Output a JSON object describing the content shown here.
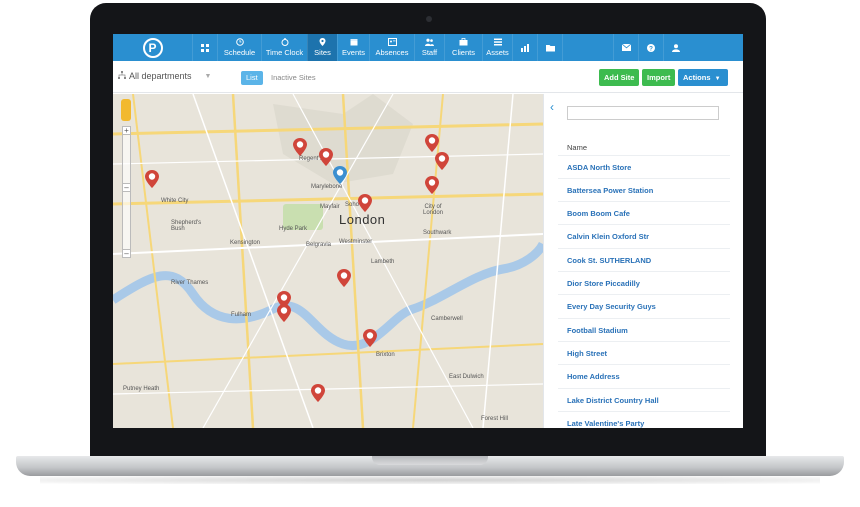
{
  "app": {
    "logo_letter": "P"
  },
  "nav": {
    "items": [
      {
        "label": "Schedule",
        "icon": "clock-icon"
      },
      {
        "label": "Time Clock",
        "icon": "stopwatch-icon"
      },
      {
        "label": "Sites",
        "icon": "map-pin-icon",
        "active": true
      },
      {
        "label": "Events",
        "icon": "calendar-icon"
      },
      {
        "label": "Absences",
        "icon": "id-card-icon"
      },
      {
        "label": "Staff",
        "icon": "people-icon"
      },
      {
        "label": "Clients",
        "icon": "briefcase-icon"
      },
      {
        "label": "Assets",
        "icon": "list-icon"
      }
    ],
    "right_icons": [
      "bar-chart-icon",
      "folder-icon",
      "mail-icon",
      "help-icon",
      "user-icon"
    ]
  },
  "toolbar": {
    "department": "All departments",
    "tab_active": "List",
    "tab_inactive": "Inactive Sites",
    "add_site": "Add Site",
    "import": "Import",
    "actions": "Actions"
  },
  "map": {
    "city": "London",
    "labels": [
      "Regent's",
      "Marylebone",
      "Soho",
      "Mayfair",
      "City of London",
      "White City",
      "Shepherd's Bush",
      "Hyde Park",
      "Kensington",
      "Belgravia",
      "Westminster",
      "Southwark",
      "Lambeth",
      "Fulham",
      "Camberwell",
      "Brixton",
      "East Dulwich",
      "Putney Heath",
      "River Thames",
      "Forest Hill"
    ]
  },
  "sidebar": {
    "search_placeholder": "",
    "column_header": "Name",
    "sites": [
      "ASDA North Store",
      "Battersea Power Station",
      "Boom Boom Cafe",
      "Calvin Klein Oxford Str",
      "Cook St. SUTHERLAND",
      "Dior Store Piccadilly",
      "Every Day Security Guys",
      "Football Stadium",
      "High Street",
      "Home Address",
      "Lake District Country Hall",
      "Late Valentine's Party"
    ]
  },
  "colors": {
    "primary": "#2a8fd0",
    "active": "#1d73ad",
    "green": "#3dbb4f",
    "pin_red": "#d0453a",
    "pin_blue": "#3b8fd0"
  }
}
